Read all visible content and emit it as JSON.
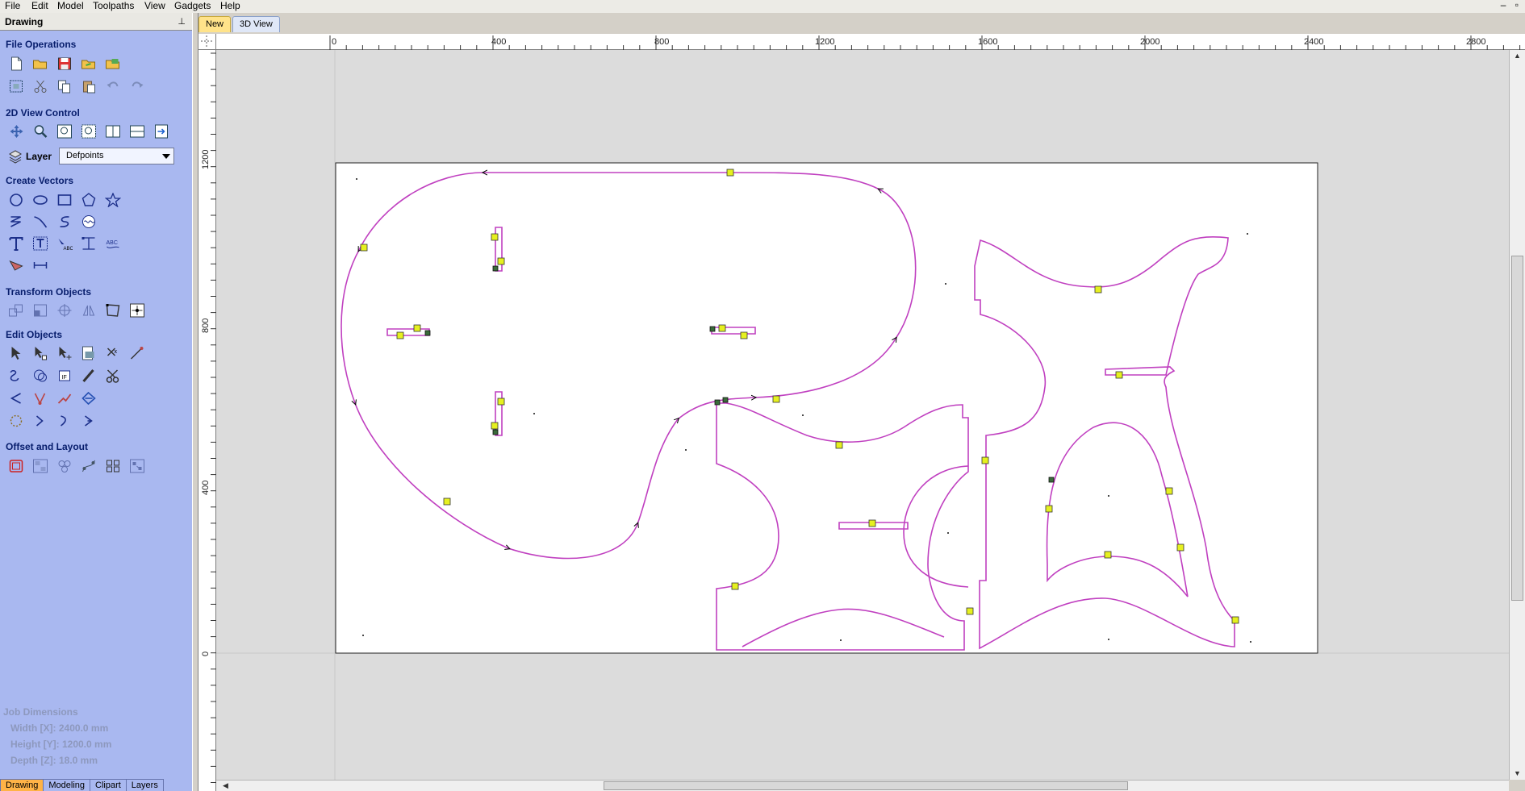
{
  "menu": [
    "File",
    "Edit",
    "Model",
    "Toolpaths",
    "View",
    "Gadgets",
    "Help"
  ],
  "window_controls": "– ▫",
  "panel": {
    "title": "Drawing",
    "pin": "📌",
    "sections": {
      "file_operations": "File Operations",
      "view_control": "2D View Control",
      "create_vectors": "Create Vectors",
      "transform_objects": "Transform Objects",
      "edit_objects": "Edit Objects",
      "offset_layout": "Offset and Layout"
    },
    "layer": {
      "label": "Layer",
      "selected": "Defpoints"
    },
    "job_dimensions": {
      "title": "Job Dimensions",
      "width": "Width  [X]: 2400.0 mm",
      "height": "Height [Y]: 1200.0 mm",
      "depth": "Depth  [Z]: 18.0 mm"
    },
    "tabs": [
      "Drawing",
      "Modeling",
      "Clipart",
      "Layers"
    ]
  },
  "document_tabs": [
    "New",
    "3D View"
  ],
  "ruler_top": [
    "0",
    "400",
    "800",
    "1200",
    "1600",
    "2000",
    "2400",
    "2800"
  ],
  "ruler_left": [
    "1200",
    "800",
    "400",
    "0"
  ],
  "colors": {
    "vector": "#c040c0",
    "panel": "#a9b8f0",
    "section_text": "#071d6c"
  },
  "icons": {
    "file": [
      "new-file-icon",
      "open-file-icon",
      "save-file-icon",
      "import-vectors-icon",
      "import-bitmap-icon",
      "select-all-icon",
      "cut-icon",
      "copy-icon",
      "paste-icon",
      "undo-icon",
      "redo-icon"
    ],
    "view": [
      "pan-icon",
      "zoom-icon",
      "zoom-extents-icon",
      "zoom-to-fit-icon",
      "view-split-icon",
      "view-horizontal-icon",
      "view-export-icon"
    ],
    "create": [
      "circle-icon",
      "ellipse-icon",
      "rectangle-icon",
      "polygon-icon",
      "star-icon",
      "polyline-icon",
      "arc-icon",
      "curve-icon",
      "spiral-icon",
      "text-icon",
      "text-box-icon",
      "text-on-curve-icon",
      "bend-text-icon",
      "spell-icon",
      "dimension-icon",
      "measure-icon"
    ],
    "transform": [
      "move-icon",
      "scale-icon",
      "center-icon",
      "mirror-icon",
      "distort-icon",
      "align-icon"
    ],
    "edit": [
      "select-icon",
      "node-edit-icon",
      "node-add-icon",
      "interactive-icon",
      "trim-icon",
      "extend-icon",
      "weld-icon",
      "subtract-icon",
      "intersect-icon",
      "fillet-icon",
      "scissors-icon",
      "smooth-icon",
      "node-corner-icon",
      "join-icon",
      "close-vector-icon",
      "close-path-icon",
      "open-path-icon",
      "next-node-icon",
      "prev-node-icon"
    ],
    "offset": [
      "offset-icon",
      "nest-icon",
      "array-copy-icon",
      "copy-along-vector-icon",
      "grid-array-icon",
      "auto-layout-icon"
    ]
  }
}
